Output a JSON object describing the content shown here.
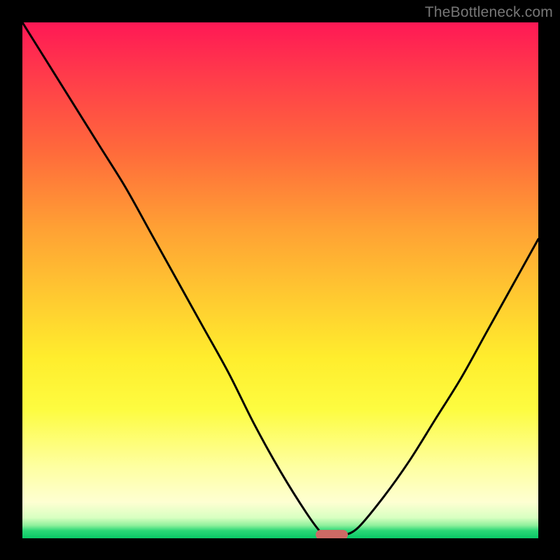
{
  "watermark": "TheBottleneck.com",
  "colors": {
    "frame": "#000000",
    "curve": "#000000",
    "marker": "#cd6a65",
    "gradient_top": "#ff1855",
    "gradient_bottom": "#09c866"
  },
  "chart_data": {
    "type": "line",
    "title": "",
    "xlabel": "",
    "ylabel": "",
    "xlim": [
      0,
      100
    ],
    "ylim": [
      0,
      100
    ],
    "x": [
      0,
      5,
      10,
      15,
      20,
      25,
      30,
      35,
      40,
      45,
      50,
      55,
      58,
      60,
      62,
      65,
      70,
      75,
      80,
      85,
      90,
      95,
      100
    ],
    "values": [
      100,
      92,
      84,
      76,
      68,
      59,
      50,
      41,
      32,
      22,
      13,
      5,
      1,
      0,
      0.5,
      2,
      8,
      15,
      23,
      31,
      40,
      49,
      58
    ],
    "marker_plateau": {
      "x_start": 57,
      "x_end": 63,
      "y": 0
    },
    "notes": "Black V-shaped curve on a vertical red→orange→yellow→green gradient, framed by a thick black border. Minimum (y≈0) occurs around x≈60 where a small rounded salmon pill sits on the baseline. No axes, ticks, or numeric labels are visible."
  }
}
